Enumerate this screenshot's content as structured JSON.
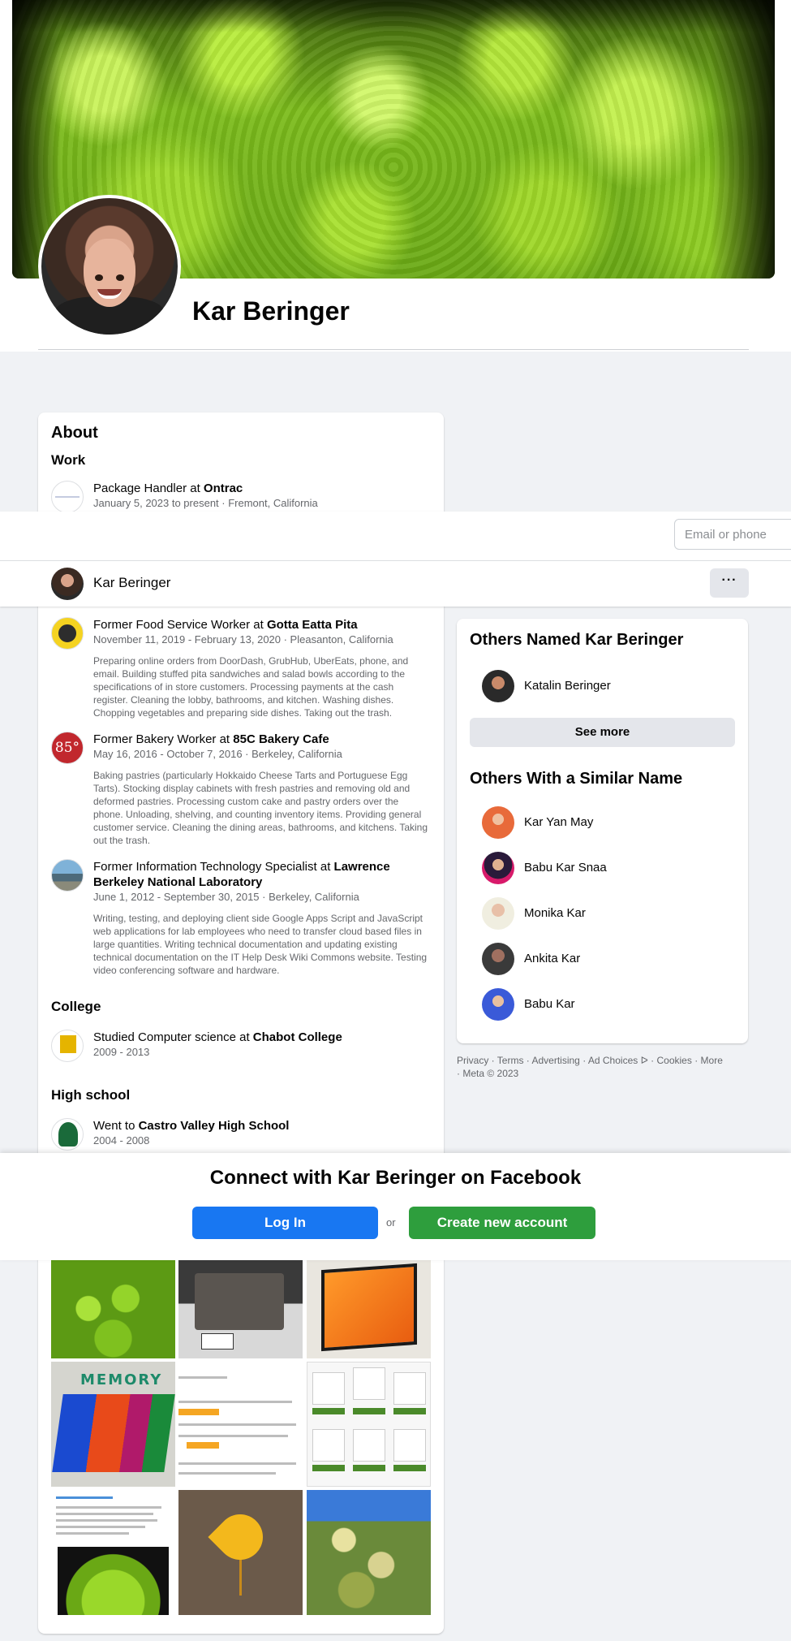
{
  "profile": {
    "name": "Kar Beringer"
  },
  "about": {
    "title": "About",
    "work_heading": "Work",
    "work": [
      {
        "role_prefix": "Package Handler at ",
        "employer": "Ontrac",
        "meta": "January 5, 2023 to present · Fremont, California",
        "description": ""
      },
      {
        "role_prefix": "Former Food Service Worker at ",
        "employer": "Gotta Eatta Pita",
        "meta": "November 11, 2019 - February 13, 2020 · Pleasanton, California",
        "description": "Preparing online orders from DoorDash, GrubHub, UberEats, phone, and email. Building stuffed pita sandwiches and salad bowls according to the specifications of in store customers. Processing payments at the cash register. Cleaning the lobby, bathrooms, and kitchen. Washing dishes. Chopping vegetables and preparing side dishes. Taking out the trash."
      },
      {
        "role_prefix": "Former Bakery Worker at ",
        "employer": "85C Bakery Cafe",
        "meta": "May 16, 2016 - October 7, 2016 · Berkeley, California",
        "description": "Baking pastries (particularly Hokkaido Cheese Tarts and Portuguese Egg Tarts). Stocking display cabinets with fresh pastries and removing old and deformed pastries. Processing custom cake and pastry orders over the phone. Unloading, shelving, and counting inventory items. Providing general customer service. Cleaning the dining areas, bathrooms, and kitchens. Taking out the trash."
      },
      {
        "role_prefix": "Former Information Technology Specialist at ",
        "employer": "Lawrence Berkeley National Laboratory",
        "meta": "June 1, 2012 - September 30, 2015 · Berkeley, California",
        "description": "Writing, testing, and deploying client side Google Apps Script and JavaScript web applications for lab employees who need to transfer cloud based files in large quantities. Writing technical documentation and updating existing technical documentation on the IT Help Desk Wiki Commons website. Testing video conferencing software and hardware."
      }
    ],
    "college_heading": "College",
    "college": {
      "prefix": "Studied Computer science at ",
      "school": "Chabot College",
      "years": "2009 - 2013"
    },
    "highschool_heading": "High school",
    "highschool": {
      "prefix": "Went to ",
      "school": "Castro Valley High School",
      "years": "2004 - 2008"
    }
  },
  "login_bar": {
    "email_placeholder": "Email or phone"
  },
  "name_bar": {
    "name": "Kar Beringer",
    "more_label": "···"
  },
  "sidebar": {
    "others_named_heading": "Others Named Kar Beringer",
    "others_named": [
      "Katalin Beringer"
    ],
    "see_more_label": "See more",
    "similar_heading": "Others With a Similar Name",
    "similar": [
      "Kar Yan May",
      "Babu Kar Snaa",
      "Monika Kar",
      "Ankita Kar",
      "Babu Kar"
    ]
  },
  "footer": {
    "links": [
      "Privacy",
      "Terms",
      "Advertising",
      "Ad Choices",
      "Cookies",
      "More"
    ],
    "copyright": "Meta © 2023"
  },
  "connect": {
    "title": "Connect with Kar Beringer on Facebook",
    "login_label": "Log In",
    "or_label": "or",
    "create_label": "Create new account"
  },
  "photos": {
    "ph4_text": "MEMORY"
  },
  "colors": {
    "primary": "#1877f2",
    "create_green": "#2e9e3d",
    "background": "#f0f2f5"
  }
}
